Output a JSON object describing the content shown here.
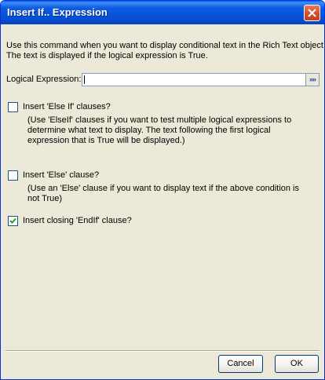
{
  "window": {
    "title": "Insert If.. Expression"
  },
  "intro": {
    "line1": "Use this command when you want to display conditional text in the Rich Text object.",
    "line2": "The text is displayed if the logical expression is True."
  },
  "expression": {
    "label": "Logical Expression:",
    "value": "",
    "picker_label": "»»"
  },
  "options": {
    "else_if": {
      "label": "Insert 'Else If' clauses?",
      "checked": false,
      "help_line1": "(Use 'ElseIf' clauses if you want to test multiple logical expressions to",
      "help_line2": "determine what text to display. The text following the first logical",
      "help_line3": "expression that is True will be displayed.)"
    },
    "else": {
      "label": "Insert 'Else' clause?",
      "checked": false,
      "help_line1": "(Use an 'Else' clause if you want to display text if the above condition is",
      "help_line2": "not True)"
    },
    "end_if": {
      "label": "Insert closing 'EndIf' clause?",
      "checked": true
    }
  },
  "buttons": {
    "cancel": "Cancel",
    "ok": "OK"
  }
}
